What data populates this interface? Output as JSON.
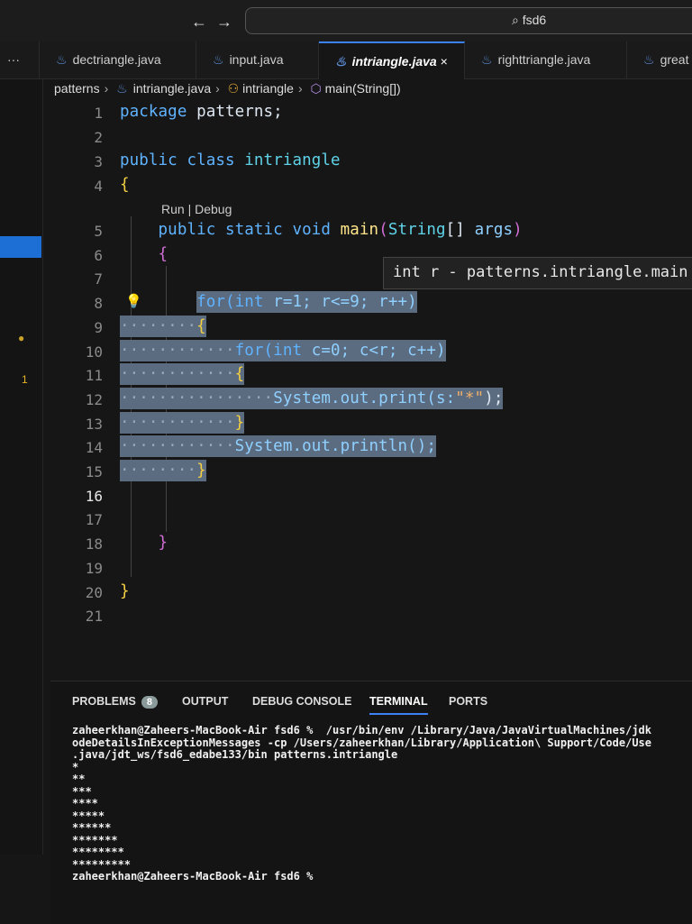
{
  "titlebar": {
    "back": "←",
    "forward": "→",
    "search": "⌕ fsd6"
  },
  "tabs": [
    {
      "label": "dectriangle.java"
    },
    {
      "label": "input.java"
    },
    {
      "label": "intriangle.java",
      "close": "×"
    },
    {
      "label": "righttriangle.java"
    },
    {
      "label": "great"
    }
  ],
  "more": "···",
  "breadcrumb": {
    "folder": "patterns",
    "file": "intriangle.java",
    "cls": "intriangle",
    "method": "main(String[])"
  },
  "codelens": "Run | Debug",
  "hover": "int r - patterns.intriangle.main",
  "gutter": {
    "dot": "●",
    "count": "1"
  },
  "lines": [
    {
      "n": "1",
      "t": [
        [
          "package ",
          "kw"
        ],
        [
          "patterns;",
          "tx"
        ]
      ]
    },
    {
      "n": "2",
      "t": []
    },
    {
      "n": "3",
      "t": [
        [
          "public class ",
          "kw"
        ],
        [
          "intriangle",
          "ty"
        ]
      ]
    },
    {
      "n": "4",
      "t": [
        [
          "{",
          "br"
        ]
      ]
    },
    {
      "n": "5",
      "t": [
        [
          "    "
        ],
        [
          "public static void ",
          "kw"
        ],
        [
          "main",
          "fn"
        ],
        [
          "(",
          "br2"
        ],
        [
          "String",
          "ty"
        ],
        [
          "[] ",
          "tx"
        ],
        [
          "args",
          "id"
        ],
        [
          ")",
          "br2"
        ]
      ]
    },
    {
      "n": "6",
      "t": [
        [
          "    "
        ],
        [
          "{",
          "br2"
        ]
      ]
    },
    {
      "n": "7",
      "t": []
    },
    {
      "n": "8",
      "t": [
        [
          "        "
        ],
        [
          "for(int ",
          "kw",
          "s"
        ],
        [
          "r=1; r<=9; r++)",
          "id",
          "s"
        ]
      ]
    },
    {
      "n": "9",
      "t": [
        [
          "········",
          "ws",
          "s"
        ],
        [
          "{",
          "br",
          "s"
        ]
      ]
    },
    {
      "n": "10",
      "t": [
        [
          "············",
          "ws",
          "s"
        ],
        [
          "for(int ",
          "kw",
          "s"
        ],
        [
          "c=0; c<r; c++)",
          "id",
          "s"
        ]
      ]
    },
    {
      "n": "11",
      "t": [
        [
          "············",
          "ws",
          "s"
        ],
        [
          "{",
          "br",
          "s"
        ]
      ]
    },
    {
      "n": "12",
      "t": [
        [
          "················",
          "ws",
          "s"
        ],
        [
          "System.out.print(s:",
          "id",
          "s"
        ],
        [
          "\"*\"",
          "str",
          "s"
        ],
        [
          ");",
          "tx",
          "s"
        ]
      ]
    },
    {
      "n": "13",
      "t": [
        [
          "············",
          "ws",
          "s"
        ],
        [
          "}",
          "br",
          "s"
        ]
      ]
    },
    {
      "n": "14",
      "t": [
        [
          "············",
          "ws",
          "s"
        ],
        [
          "System.out.println();",
          "id",
          "s"
        ]
      ]
    },
    {
      "n": "15",
      "t": [
        [
          "········",
          "ws",
          "s"
        ],
        [
          "}",
          "br",
          "s"
        ]
      ]
    },
    {
      "n": "16",
      "t": []
    },
    {
      "n": "17",
      "t": []
    },
    {
      "n": "18",
      "t": [
        [
          "    "
        ],
        [
          "}",
          "br2"
        ]
      ]
    },
    {
      "n": "19",
      "t": []
    },
    {
      "n": "20",
      "t": [
        [
          "}",
          "br"
        ]
      ]
    },
    {
      "n": "21",
      "t": []
    }
  ],
  "panel": {
    "tabs": [
      "PROBLEMS",
      "OUTPUT",
      "DEBUG CONSOLE",
      "TERMINAL",
      "PORTS"
    ],
    "problems_count": "8"
  },
  "terminal": "zaheerkhan@Zaheers-MacBook-Air fsd6 %  /usr/bin/env /Library/Java/JavaVirtualMachines/jdk\nodeDetailsInExceptionMessages -cp /Users/zaheerkhan/Library/Application\\ Support/Code/Use\n.java/jdt_ws/fsd6_edabe133/bin patterns.intriangle\n*\n**\n***\n****\n*****\n******\n*******\n********\n*********\nzaheerkhan@Zaheers-MacBook-Air fsd6 %"
}
